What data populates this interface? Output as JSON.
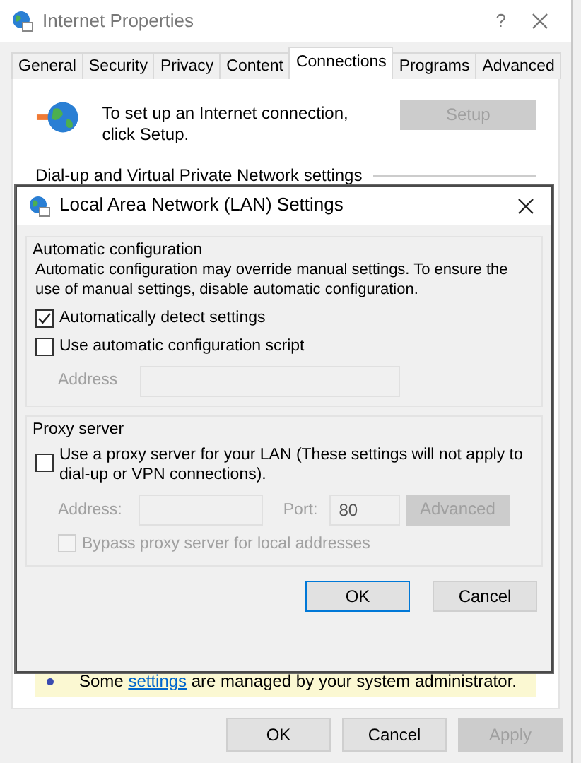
{
  "window": {
    "title": "Internet Properties",
    "help_button": "?"
  },
  "tabs": [
    {
      "label": "General",
      "selected": false
    },
    {
      "label": "Security",
      "selected": false
    },
    {
      "label": "Privacy",
      "selected": false
    },
    {
      "label": "Content",
      "selected": false
    },
    {
      "label": "Connections",
      "selected": true
    },
    {
      "label": "Programs",
      "selected": false
    },
    {
      "label": "Advanced",
      "selected": false
    }
  ],
  "connections_page": {
    "setup_text": "To set up an Internet connection, click Setup.",
    "setup_button": {
      "label": "Setup",
      "disabled": true
    },
    "dialup_heading": "Dial-up and Virtual Private Network settings",
    "notice": {
      "before": "Some ",
      "link": "settings",
      "after": " are managed by your system administrator."
    }
  },
  "lan_dialog": {
    "title": "Local Area Network (LAN) Settings",
    "auto_config": {
      "heading": "Automatic configuration",
      "description": "Automatic configuration may override manual settings.  To ensure the use of manual settings, disable automatic configuration.",
      "options": [
        {
          "label": "Automatically detect settings",
          "checked": true,
          "disabled": false
        },
        {
          "label": "Use automatic configuration script",
          "checked": false,
          "disabled": false
        }
      ],
      "address": {
        "label": "Address",
        "disabled": true
      }
    },
    "proxy": {
      "heading": "Proxy server",
      "use_proxy": {
        "label": "Use a proxy server for your LAN (These settings will not apply to dial-up or VPN connections).",
        "checked": false,
        "disabled": false
      },
      "address": {
        "label": "Address:",
        "disabled": true
      },
      "port": {
        "label": "Port:",
        "value": "80",
        "disabled": true
      },
      "advanced_button": {
        "label": "Advanced",
        "disabled": true
      },
      "bypass": {
        "label": "Bypass proxy server for local addresses",
        "checked": false,
        "disabled": true
      }
    },
    "buttons": [
      {
        "label": "OK",
        "default": true
      },
      {
        "label": "Cancel",
        "default": false
      }
    ]
  },
  "buttons": [
    {
      "label": "OK",
      "disabled": false
    },
    {
      "label": "Cancel",
      "disabled": false
    },
    {
      "label": "Apply",
      "disabled": true
    }
  ]
}
